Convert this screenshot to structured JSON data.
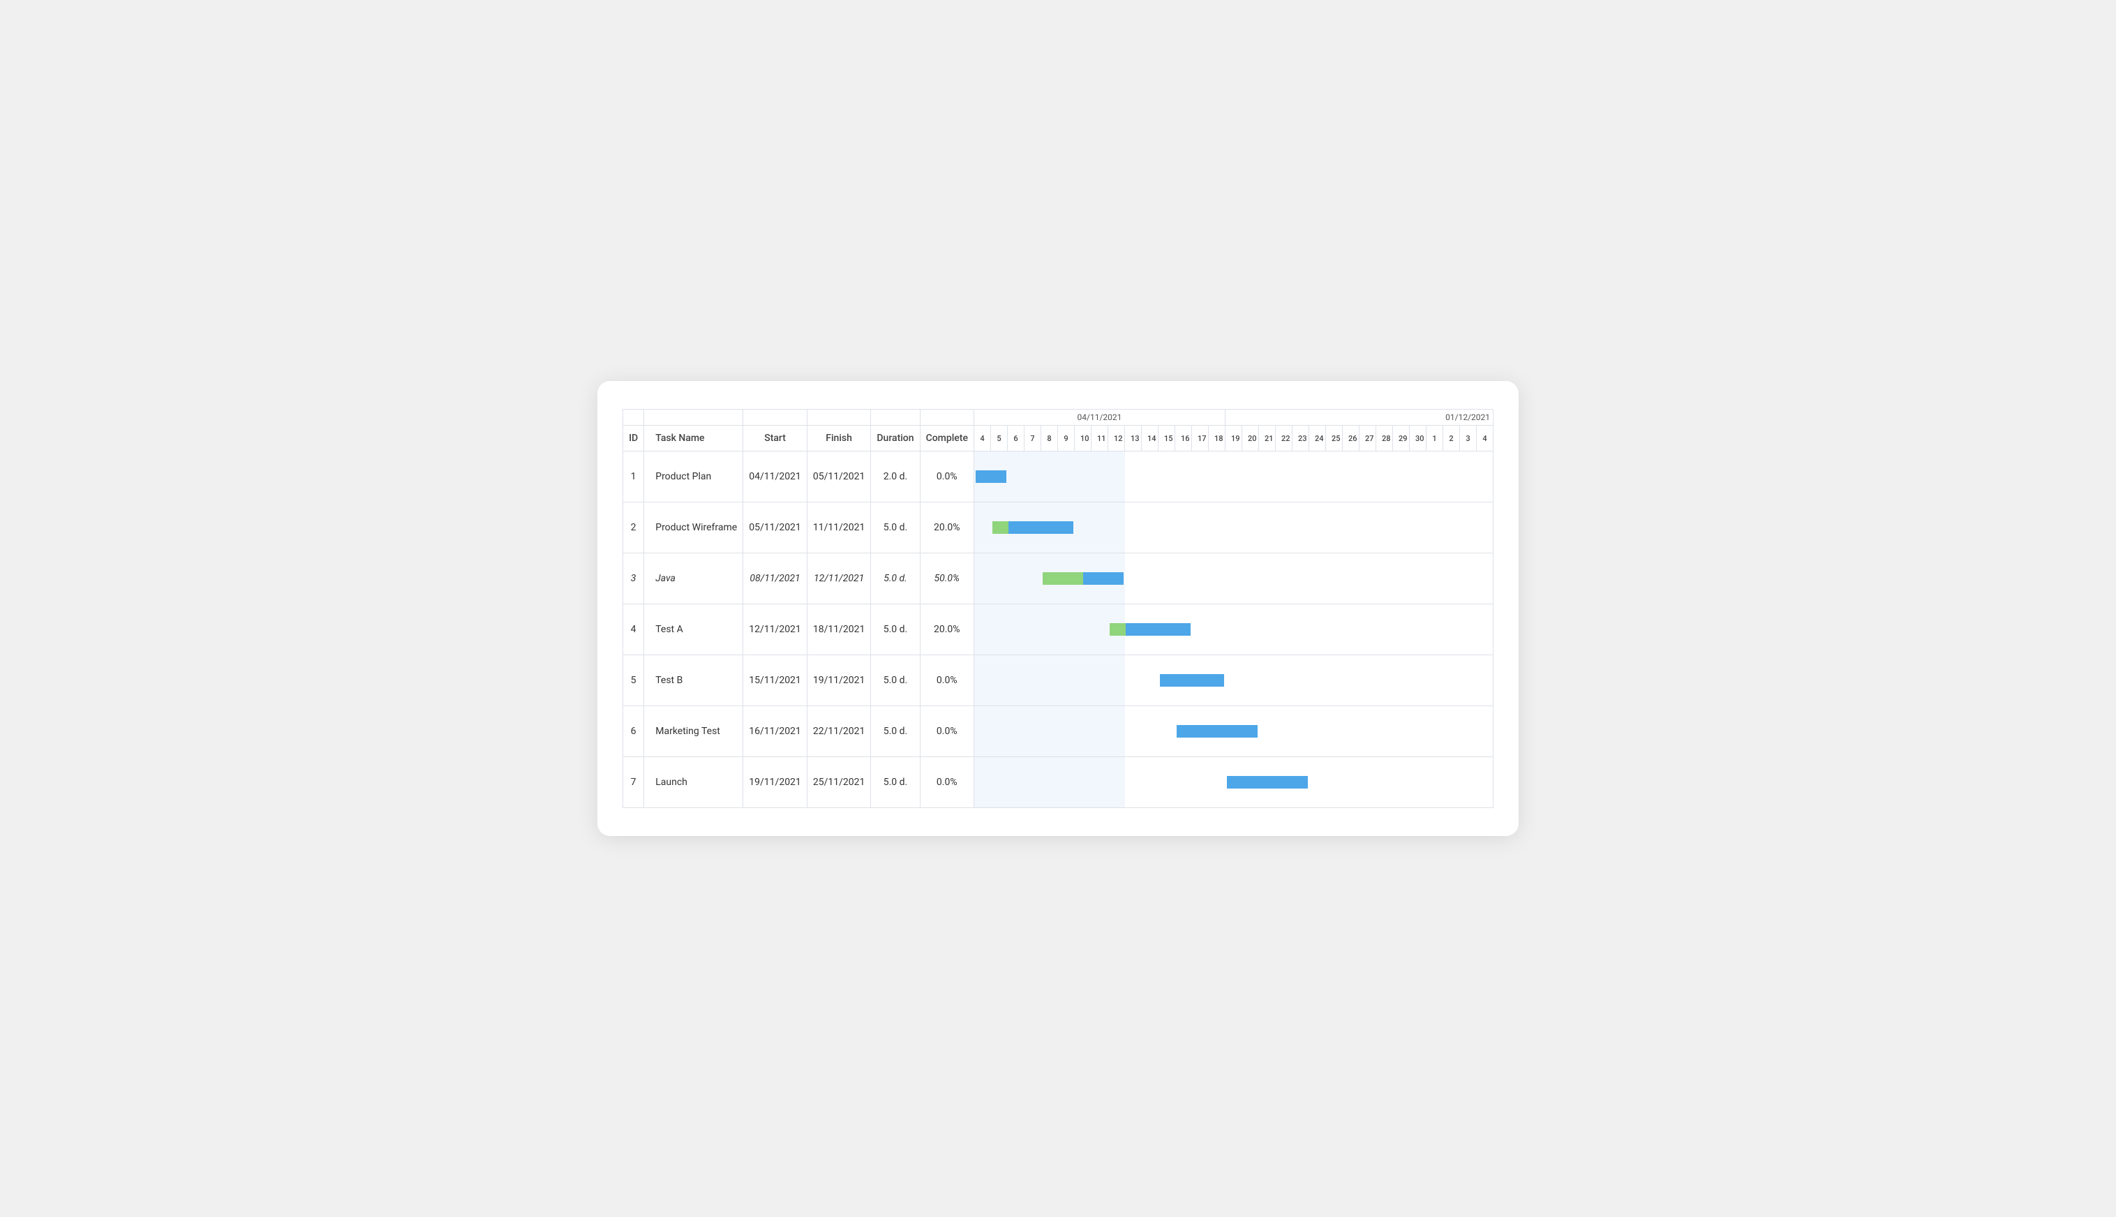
{
  "header": {
    "date1": "04/11/2021",
    "date2": "01/12/2021",
    "columns": {
      "id": "ID",
      "task_name": "Task Name",
      "start": "Start",
      "finish": "Finish",
      "duration": "Duration",
      "complete": "Complete"
    },
    "days": [
      "4",
      "5",
      "6",
      "7",
      "8",
      "9",
      "10",
      "11",
      "12",
      "13",
      "14",
      "15",
      "16",
      "17",
      "18",
      "19",
      "20",
      "21",
      "22",
      "23",
      "24",
      "25",
      "26",
      "27",
      "28",
      "29",
      "30",
      "1",
      "2",
      "3",
      "4"
    ]
  },
  "rows": [
    {
      "id": "1",
      "name": "Product Plan",
      "start": "04/11/2021",
      "finish": "05/11/2021",
      "duration": "2.0 d.",
      "complete": "0.0%",
      "italic": false,
      "barStart": 0,
      "barWidth": 2,
      "completePct": 0,
      "shadeStart": 0,
      "shadeWidth": 5
    },
    {
      "id": "2",
      "name": "Product Wireframe",
      "start": "05/11/2021",
      "finish": "11/11/2021",
      "duration": "5.0 d.",
      "complete": "20.0%",
      "italic": false,
      "barStart": 1,
      "barWidth": 5,
      "completePct": 20,
      "shadeStart": 0,
      "shadeWidth": 5
    },
    {
      "id": "3",
      "name": "Java",
      "start": "08/11/2021",
      "finish": "12/11/2021",
      "duration": "5.0 d.",
      "complete": "50.0%",
      "italic": true,
      "barStart": 4,
      "barWidth": 5,
      "completePct": 50,
      "shadeStart": 0,
      "shadeWidth": 8
    },
    {
      "id": "4",
      "name": "Test A",
      "start": "12/11/2021",
      "finish": "18/11/2021",
      "duration": "5.0 d.",
      "complete": "20.0%",
      "italic": false,
      "barStart": 8,
      "barWidth": 5,
      "completePct": 20,
      "shadeStart": 0,
      "shadeWidth": 12
    },
    {
      "id": "5",
      "name": "Test B",
      "start": "15/11/2021",
      "finish": "19/11/2021",
      "duration": "5.0 d.",
      "complete": "0.0%",
      "italic": false,
      "barStart": 11,
      "barWidth": 4,
      "completePct": 0,
      "shadeStart": 0,
      "shadeWidth": 12
    },
    {
      "id": "6",
      "name": "Marketing Test",
      "start": "16/11/2021",
      "finish": "22/11/2021",
      "duration": "5.0 d.",
      "complete": "0.0%",
      "italic": false,
      "barStart": 12,
      "barWidth": 5,
      "completePct": 0,
      "shadeStart": 0,
      "shadeWidth": 12
    },
    {
      "id": "7",
      "name": "Launch",
      "start": "19/11/2021",
      "finish": "25/11/2021",
      "duration": "5.0 d.",
      "complete": "0.0%",
      "italic": false,
      "barStart": 15,
      "barWidth": 5,
      "completePct": 0,
      "shadeStart": 0,
      "shadeWidth": 12
    }
  ],
  "colors": {
    "bar_complete": "#90d47c",
    "bar_remaining": "#4da6e8",
    "shade": "#deedf9",
    "border": "#dde1e7",
    "header_bg": "#ffffff",
    "row_bg": "#ffffff"
  }
}
